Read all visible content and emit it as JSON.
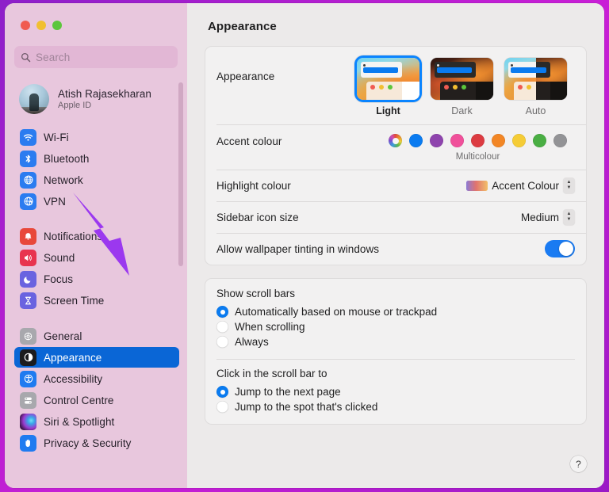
{
  "window": {
    "traffic_lights": [
      "close",
      "minimize",
      "maximize"
    ],
    "border_color": "#b31fd0"
  },
  "sidebar": {
    "search": {
      "placeholder": "Search",
      "value": "",
      "icon": "search-icon"
    },
    "account": {
      "name": "Atish Rajasekharan",
      "subtitle": "Apple ID"
    },
    "groups": [
      {
        "items": [
          {
            "label": "Wi-Fi",
            "icon": "wifi-icon",
            "color": "#2b7cf0",
            "selected": false
          },
          {
            "label": "Bluetooth",
            "icon": "bluetooth-icon",
            "color": "#2b7cf0",
            "selected": false
          },
          {
            "label": "Network",
            "icon": "globe-icon",
            "color": "#2b7cf0",
            "selected": false
          },
          {
            "label": "VPN",
            "icon": "vpn-globe-icon",
            "color": "#2b7cf0",
            "selected": false
          }
        ]
      },
      {
        "items": [
          {
            "label": "Notifications",
            "icon": "bell-icon",
            "color": "#e8483a",
            "selected": false
          },
          {
            "label": "Sound",
            "icon": "speaker-icon",
            "color": "#e8344f",
            "selected": false
          },
          {
            "label": "Focus",
            "icon": "moon-icon",
            "color": "#6a63e0",
            "selected": false
          },
          {
            "label": "Screen Time",
            "icon": "hourglass-icon",
            "color": "#6a63e0",
            "selected": false
          }
        ]
      },
      {
        "items": [
          {
            "label": "General",
            "icon": "gear-icon",
            "color": "#8e8e93",
            "selected": false
          },
          {
            "label": "Appearance",
            "icon": "appearance-icon",
            "color": "#1c1c1e",
            "selected": true
          },
          {
            "label": "Accessibility",
            "icon": "accessibility-icon",
            "color": "#1f7bf0",
            "selected": false
          },
          {
            "label": "Control Centre",
            "icon": "control-centre-icon",
            "color": "#8e8e93",
            "selected": false
          },
          {
            "label": "Siri & Spotlight",
            "icon": "siri-icon",
            "color": "#2a1a3a",
            "selected": false
          },
          {
            "label": "Privacy & Security",
            "icon": "hand-icon",
            "color": "#1f7bf0",
            "selected": false
          }
        ]
      }
    ]
  },
  "pane": {
    "title": "Appearance",
    "appearance": {
      "label": "Appearance",
      "options": [
        {
          "caption": "Light",
          "selected": true
        },
        {
          "caption": "Dark",
          "selected": false
        },
        {
          "caption": "Auto",
          "selected": false
        }
      ]
    },
    "accent": {
      "label": "Accent colour",
      "caption": "Multicolour",
      "selected_index": 0,
      "swatches": [
        {
          "name": "Multicolour",
          "color": "multi"
        },
        {
          "name": "Blue",
          "color": "#0a7bf0"
        },
        {
          "name": "Purple",
          "color": "#8e44ad"
        },
        {
          "name": "Pink",
          "color": "#f0509a"
        },
        {
          "name": "Red",
          "color": "#dc3b41"
        },
        {
          "name": "Orange",
          "color": "#f28625"
        },
        {
          "name": "Yellow",
          "color": "#f5cc36"
        },
        {
          "name": "Green",
          "color": "#4aae43"
        },
        {
          "name": "Graphite",
          "color": "#939396"
        }
      ]
    },
    "highlight": {
      "label": "Highlight colour",
      "value": "Accent Colour"
    },
    "sidebar_icon_size": {
      "label": "Sidebar icon size",
      "value": "Medium"
    },
    "wallpaper_tinting": {
      "label": "Allow wallpaper tinting in windows",
      "enabled": true
    },
    "scroll_bars": {
      "title": "Show scroll bars",
      "options": [
        {
          "label": "Automatically based on mouse or trackpad",
          "selected": true
        },
        {
          "label": "When scrolling",
          "selected": false
        },
        {
          "label": "Always",
          "selected": false
        }
      ]
    },
    "scroll_click": {
      "title": "Click in the scroll bar to",
      "options": [
        {
          "label": "Jump to the next page",
          "selected": true
        },
        {
          "label": "Jump to the spot that's clicked",
          "selected": false
        }
      ]
    },
    "help_button": "?"
  },
  "annotation": {
    "arrow_color": "#9b38ef",
    "points_at": "Network"
  }
}
